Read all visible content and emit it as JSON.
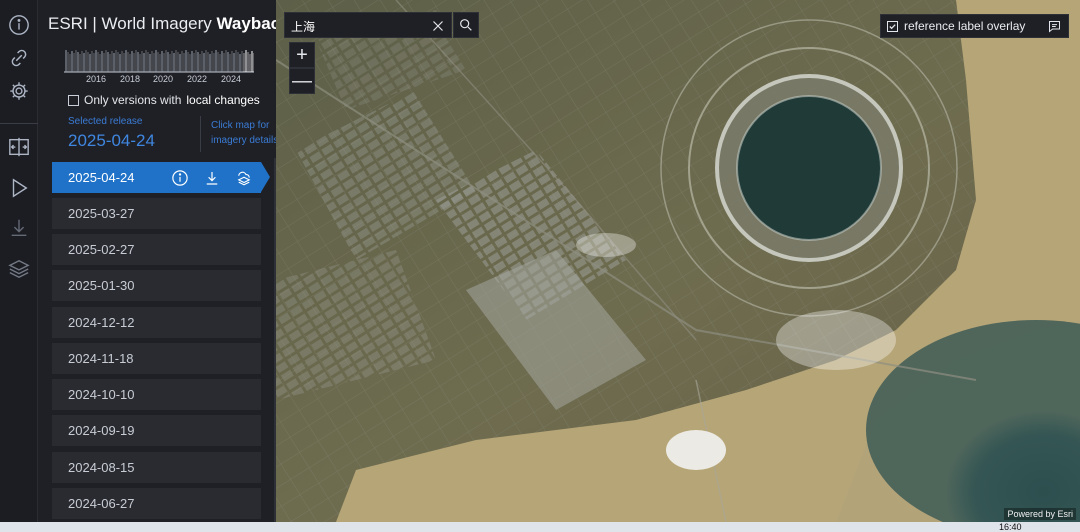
{
  "app": {
    "title_prefix": "ESRI | World Imagery",
    "title_bold": "Wayback"
  },
  "rail": {
    "icons": [
      "info-icon",
      "link-icon",
      "gear-icon",
      "swipe-icon",
      "play-icon",
      "download-icon",
      "layers-icon"
    ]
  },
  "timeline": {
    "years": [
      "2016",
      "2018",
      "2020",
      "2022",
      "2024"
    ]
  },
  "filter": {
    "label_prefix": "Only versions with",
    "label_bold": "local changes",
    "checked": false
  },
  "selected": {
    "label": "Selected release",
    "date": "2025-04-24",
    "hint": "Click map for imagery details"
  },
  "releases": [
    "2025-04-24",
    "2025-03-27",
    "2025-02-27",
    "2025-01-30",
    "2024-12-12",
    "2024-11-18",
    "2024-10-10",
    "2024-09-19",
    "2024-08-15",
    "2024-06-27"
  ],
  "active_index": 0,
  "search": {
    "value": "上海"
  },
  "zoom": {
    "in": "+",
    "out": "—"
  },
  "reference_overlay": {
    "label": "reference label overlay",
    "checked": true
  },
  "attribution": "Powered by Esri",
  "taskbar": {
    "time": "16:40"
  },
  "colors": {
    "accent": "#1f72c7",
    "panel": "#1f2025",
    "water": "#b6a577"
  }
}
